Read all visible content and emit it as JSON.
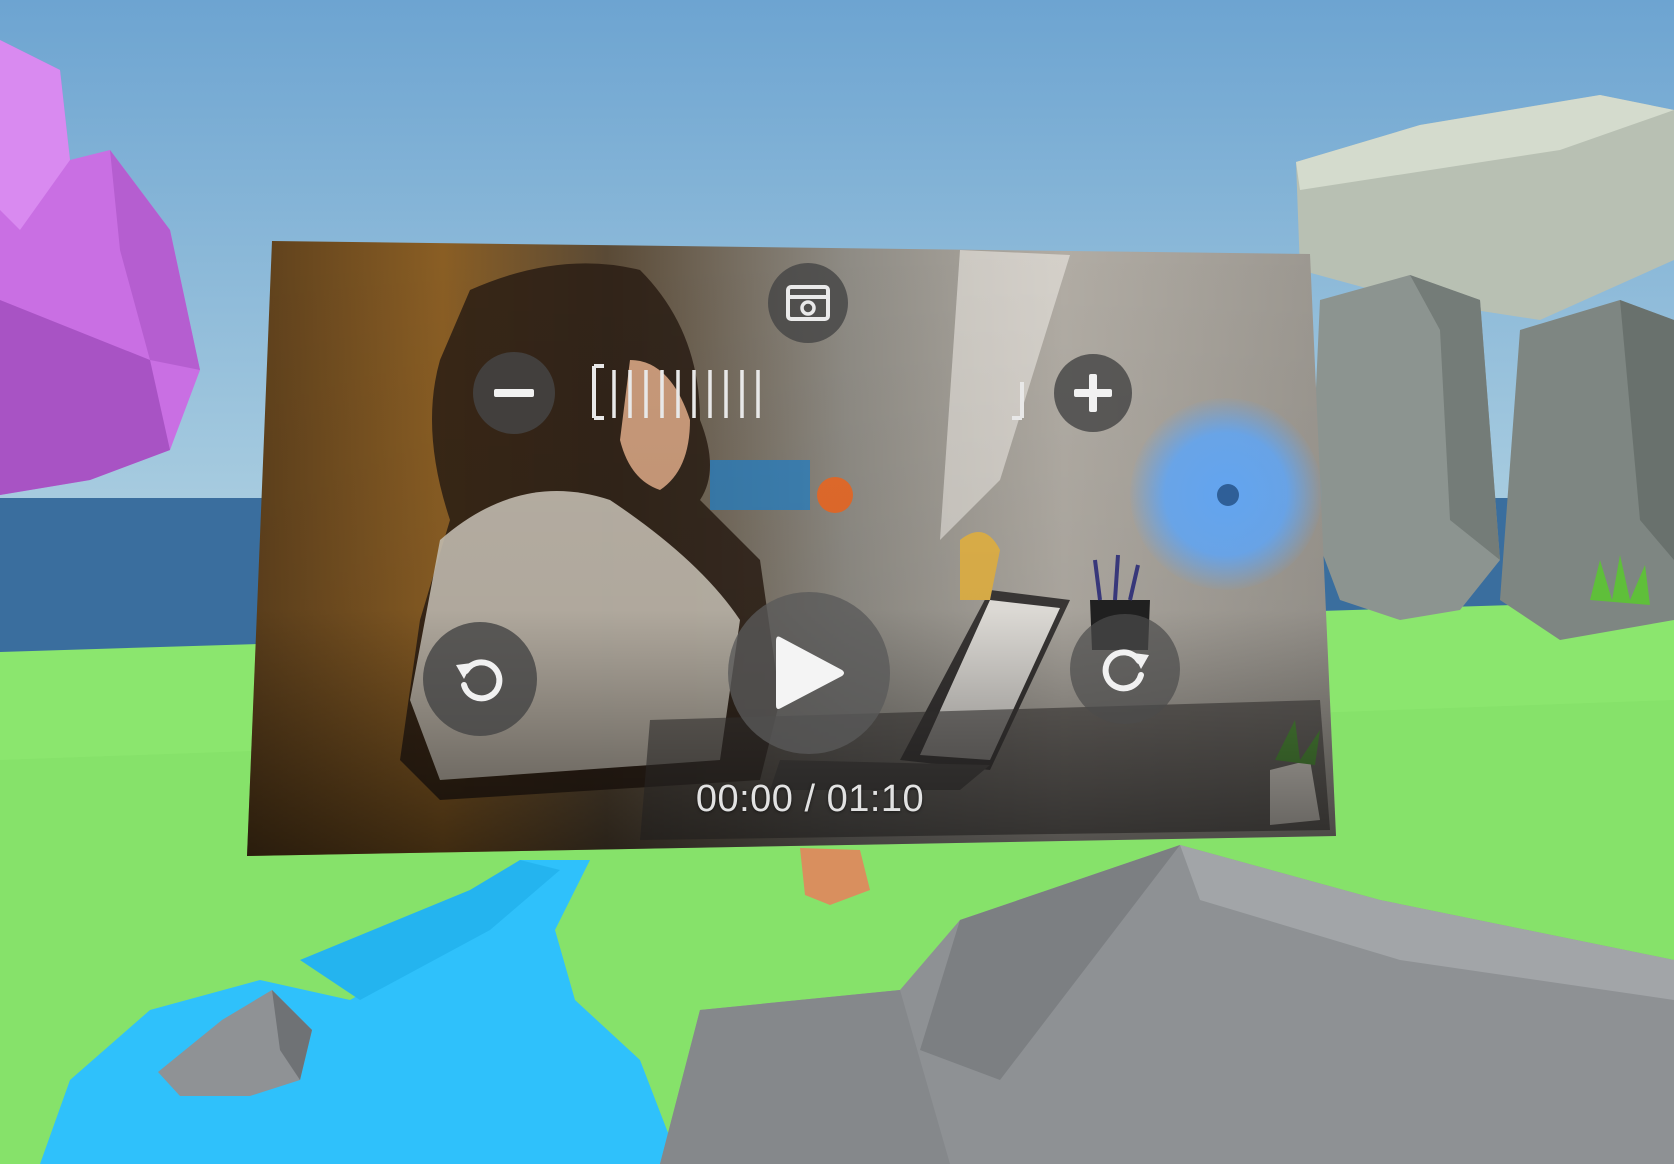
{
  "video_player": {
    "time": {
      "current": "00:00",
      "separator": " / ",
      "total": "01:10"
    },
    "volume": {
      "level": 0.4,
      "ticks_total": 25,
      "ticks_filled": 10
    },
    "controls": {
      "screen_mode_icon": "screen-mode-icon",
      "volume_down_icon": "minus-icon",
      "volume_up_icon": "plus-icon",
      "rewind_icon": "rewind-icon",
      "play_icon": "play-icon",
      "forward_icon": "forward-icon"
    }
  },
  "colors": {
    "sky_top": "#6fa6d2",
    "sky_bottom": "#a7ccdf",
    "grass": "#8ae56c",
    "river": "#2fc1fb",
    "sea": "#3b6f9f",
    "rock": "#8e9194",
    "purple_rock": "#cc72e6",
    "cursor": "#5aa5f5",
    "control_bg": "#464646"
  }
}
